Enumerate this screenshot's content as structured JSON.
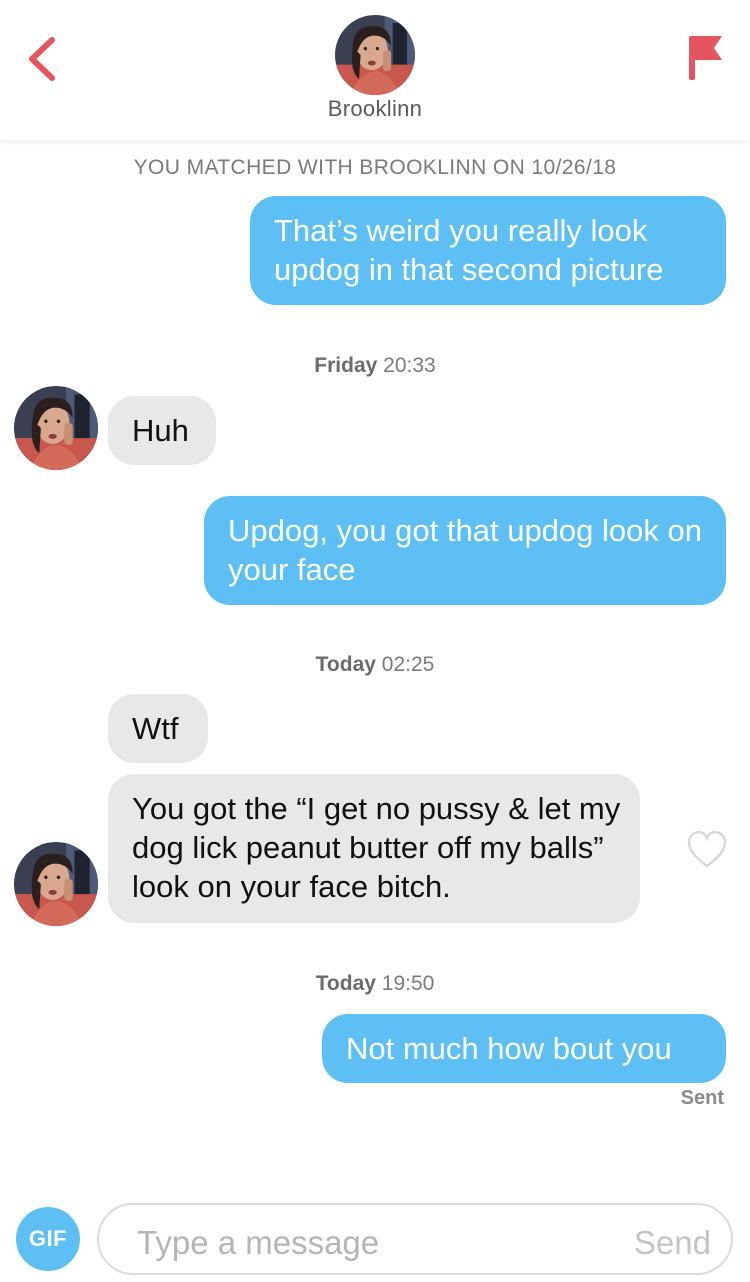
{
  "header": {
    "back_icon": "chevron-left-icon",
    "flag_icon": "flag-icon",
    "match_name": "Brooklinn",
    "accent_color": "#e5555f"
  },
  "matched_line": "YOU MATCHED WITH BROOKLINN ON 10/26/18",
  "messages": [
    {
      "direction": "outgoing",
      "text": "That’s weird you really look updog in that second picture"
    },
    {
      "timestamp": {
        "day": "Friday",
        "time": "20:33"
      }
    },
    {
      "direction": "incoming",
      "text": "Huh"
    },
    {
      "direction": "outgoing",
      "text": "Updog, you got that updog look on your face"
    },
    {
      "timestamp": {
        "day": "Today",
        "time": "02:25"
      }
    },
    {
      "direction": "incoming",
      "text": "Wtf"
    },
    {
      "direction": "incoming",
      "text": "You got the “I get no pussy & let my dog lick peanut butter off my balls” look on your face bitch."
    },
    {
      "timestamp": {
        "day": "Today",
        "time": "19:50"
      }
    },
    {
      "direction": "outgoing",
      "text": "Not much how bout you",
      "status": "Sent"
    }
  ],
  "composer": {
    "gif_label": "GIF",
    "placeholder": "Type a message",
    "send_label": "Send"
  },
  "colors": {
    "outgoing_bubble": "#5ebff5",
    "incoming_bubble": "#e8e8e8"
  }
}
